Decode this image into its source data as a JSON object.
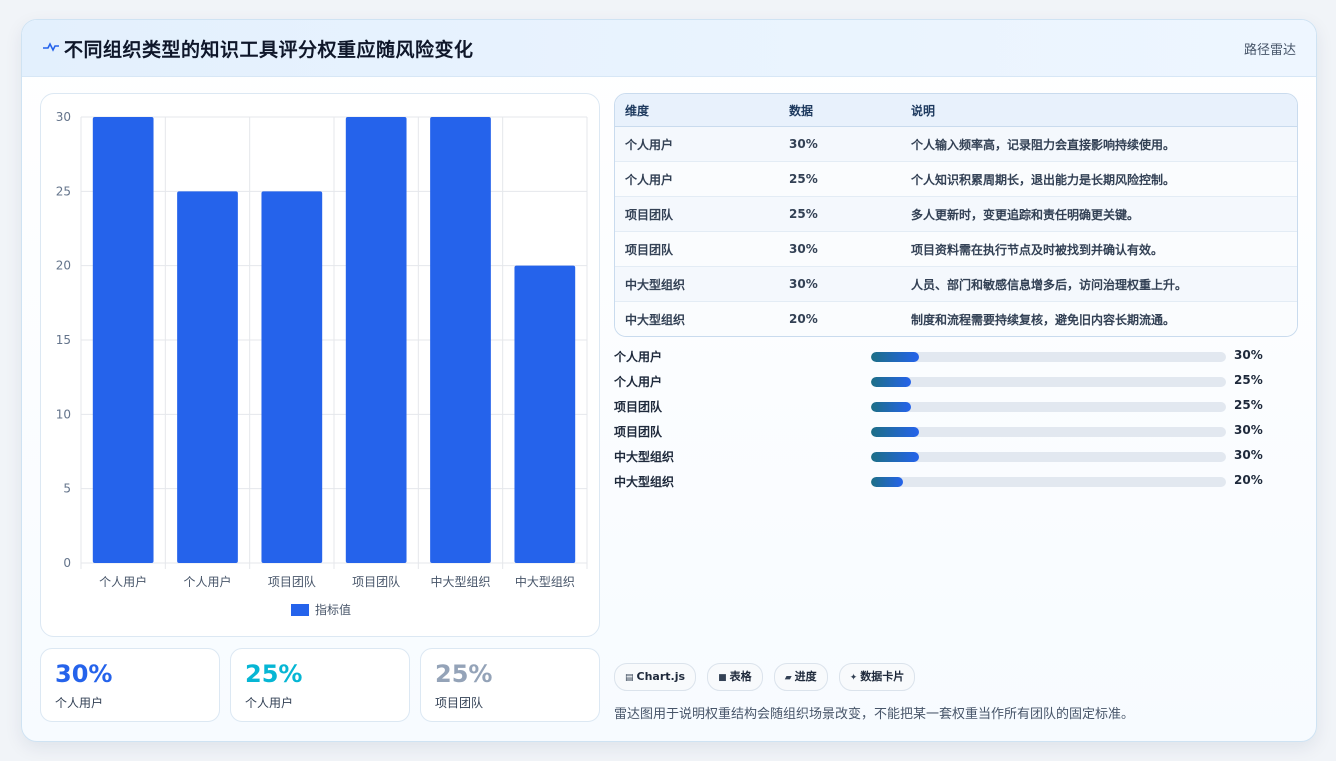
{
  "header": {
    "title": "不同组织类型的知识工具评分权重应随风险变化",
    "tag": "路径雷达"
  },
  "table": {
    "headers": [
      "维度",
      "数据",
      "说明"
    ],
    "rows": [
      [
        "个人用户",
        "30%",
        "个人输入频率高，记录阻力会直接影响持续使用。"
      ],
      [
        "个人用户",
        "25%",
        "个人知识积累周期长，退出能力是长期风险控制。"
      ],
      [
        "项目团队",
        "25%",
        "多人更新时，变更追踪和责任明确更关键。"
      ],
      [
        "项目团队",
        "30%",
        "项目资料需在执行节点及时被找到并确认有效。"
      ],
      [
        "中大型组织",
        "30%",
        "人员、部门和敏感信息增多后，访问治理权重上升。"
      ],
      [
        "中大型组织",
        "20%",
        "制度和流程需要持续复核，避免旧内容长期流通。"
      ]
    ]
  },
  "progress": [
    {
      "label": "个人用户",
      "value": "30%",
      "fraction": 0.3
    },
    {
      "label": "个人用户",
      "value": "25%",
      "fraction": 0.25
    },
    {
      "label": "项目团队",
      "value": "25%",
      "fraction": 0.25
    },
    {
      "label": "项目团队",
      "value": "30%",
      "fraction": 0.3
    },
    {
      "label": "中大型组织",
      "value": "30%",
      "fraction": 0.3
    },
    {
      "label": "中大型组织",
      "value": "20%",
      "fraction": 0.2
    }
  ],
  "stats": [
    {
      "value": "30%",
      "label": "个人用户",
      "color": "#2563eb"
    },
    {
      "value": "25%",
      "label": "个人用户",
      "color": "#06b6d4"
    },
    {
      "value": "25%",
      "label": "项目团队",
      "color": "#94a3b8"
    }
  ],
  "chips": [
    {
      "icon": "▤",
      "label": "Chart.js"
    },
    {
      "icon": "■",
      "label": "表格"
    },
    {
      "icon": "▰",
      "label": "进度"
    },
    {
      "icon": "✦",
      "label": "数据卡片"
    }
  ],
  "note": "雷达图用于说明权重结构会随组织场景改变，不能把某一套权重当作所有团队的固定标准。",
  "colors": {
    "bar": "#2563eb",
    "accent": "#2563eb",
    "grid": "#e5e7eb",
    "axis_text": "#64748b"
  },
  "chart_data": {
    "type": "bar",
    "categories": [
      "个人用户",
      "个人用户",
      "项目团队",
      "项目团队",
      "中大型组织",
      "中大型组织"
    ],
    "series": [
      {
        "name": "指标值",
        "values": [
          30,
          25,
          25,
          30,
          30,
          20
        ]
      }
    ],
    "ylim": [
      0,
      30
    ],
    "yticks": [
      0,
      5,
      10,
      15,
      20,
      25,
      30
    ],
    "grid": true,
    "legend": "bottom"
  }
}
